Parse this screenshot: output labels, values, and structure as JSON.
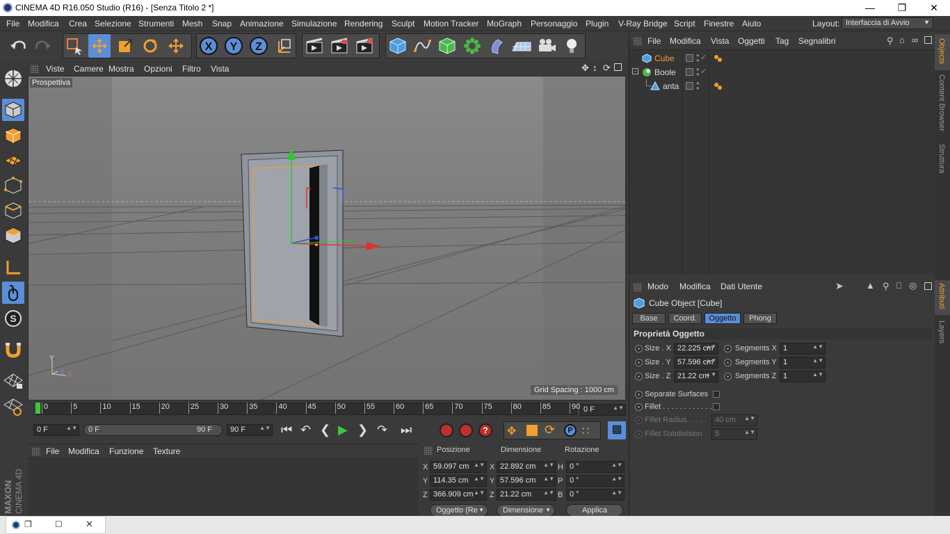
{
  "titlebar": {
    "title": "CINEMA 4D R16.050 Studio (R16) - [Senza Titolo 2 *]"
  },
  "menu": [
    "File",
    "Modifica",
    "Crea",
    "Selezione",
    "Strumenti",
    "Mesh",
    "Snap",
    "Animazione",
    "Simulazione",
    "Rendering",
    "Sculpt",
    "Motion Tracker",
    "MoGraph",
    "Personaggio",
    "Plugin",
    "V-Ray Bridge",
    "Script",
    "Finestre",
    "Aiuto"
  ],
  "layout": {
    "label": "Layout:",
    "value": "Interfaccia di Avvio"
  },
  "viewport": {
    "menu": [
      "Viste",
      "Camere",
      "Mostra",
      "Opzioni",
      "Filtro",
      "Vista"
    ],
    "camera_label": "Prospettiva",
    "grid_spacing": "Grid Spacing : 1000 cm",
    "axis_x": "X",
    "axis_y": "Y",
    "axis_z": "Z"
  },
  "timeline": {
    "ticks": [
      "0",
      "5",
      "10",
      "15",
      "20",
      "25",
      "30",
      "35",
      "40",
      "45",
      "50",
      "55",
      "60",
      "65",
      "70",
      "75",
      "80",
      "85",
      "90"
    ],
    "current_frame": "0 F"
  },
  "tcontrols": {
    "start": "0 F",
    "range_start": "0 F",
    "range_end": "90 F",
    "end": "90 F"
  },
  "material_manager": {
    "menu": [
      "File",
      "Modifica",
      "Funzione",
      "Texture"
    ]
  },
  "coord_manager": {
    "headers": [
      "Posizione",
      "Dimensione",
      "Rotazione"
    ],
    "rows": [
      {
        "axis": "X",
        "pos": "59.097 cm",
        "daxis": "X",
        "dim": "22.892 cm",
        "raxis": "H",
        "rot": "0 °"
      },
      {
        "axis": "Y",
        "pos": "114.35 cm",
        "daxis": "Y",
        "dim": "57.596 cm",
        "raxis": "P",
        "rot": "0 °"
      },
      {
        "axis": "Z",
        "pos": "366.909 cm",
        "daxis": "Z",
        "dim": "21.22 cm",
        "raxis": "B",
        "rot": "0 °"
      }
    ],
    "mode1": "Oggetto (Re",
    "mode2": "Dimensione",
    "apply": "Applica"
  },
  "object_manager": {
    "menu": [
      "File",
      "Modifica",
      "Vista",
      "Oggetti",
      "Tag",
      "Segnalibri"
    ],
    "objects": [
      {
        "name": "Cube",
        "selected": true
      },
      {
        "name": "Boole",
        "selected": false
      },
      {
        "name": "anta",
        "selected": false
      }
    ]
  },
  "attr_manager": {
    "menu": [
      "Modo",
      "Modifica",
      "Dati Utente"
    ],
    "object_title": "Cube Object [Cube]",
    "tabs": [
      "Base",
      "Coord.",
      "Oggetto",
      "Phong"
    ],
    "active_tab": "Oggetto",
    "section": "Proprietà Oggetto",
    "size": [
      {
        "label": "Size . X",
        "value": "22.225 cm"
      },
      {
        "label": "Size . Y",
        "value": "57.596 cm"
      },
      {
        "label": "Size . Z",
        "value": "21.22 cm"
      }
    ],
    "segments": [
      {
        "label": "Segments X",
        "value": "1"
      },
      {
        "label": "Segments Y",
        "value": "1"
      },
      {
        "label": "Segments Z",
        "value": "1"
      }
    ],
    "separate": "Separate Surfaces",
    "fillet": "Fillet . . . . . . . . . . . .",
    "fillet_radius": {
      "label": "Fillet Radius. . . . .",
      "value": "40 cm"
    },
    "fillet_sub": {
      "label": "Fillet Subdivision",
      "value": "5"
    }
  },
  "side_tabs": {
    "top": [
      "Objects",
      "Content Browser",
      "Struttura"
    ],
    "bottom": [
      "Attributi",
      "Layers"
    ]
  },
  "brand": {
    "maxon": "MAXON",
    "c4d": "CINEMA 4D"
  },
  "colors": {
    "accent": "#f0a030",
    "selected_blue": "#5b8ed8",
    "bg": "#3a3a3a"
  }
}
